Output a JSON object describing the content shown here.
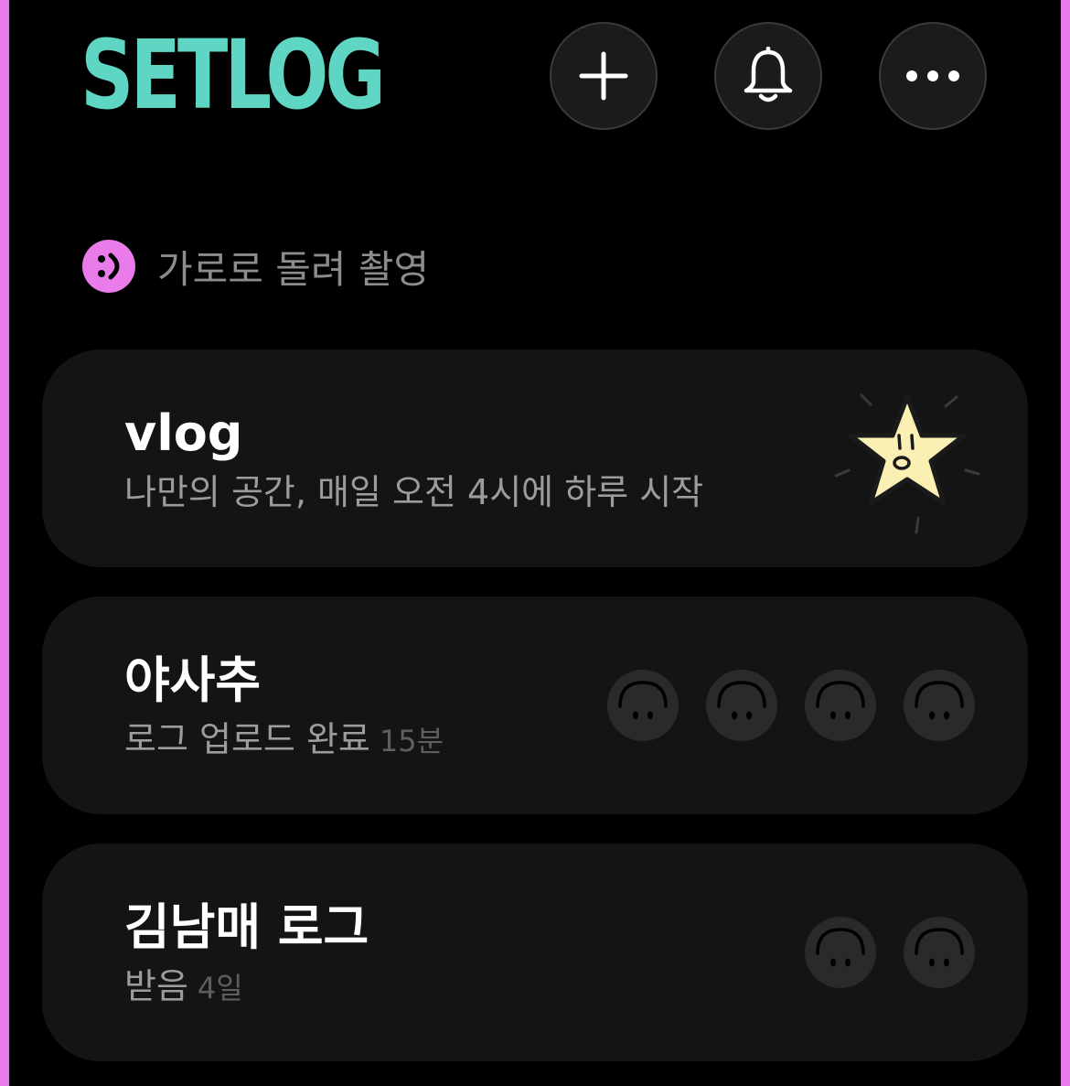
{
  "app": {
    "logo_text": "SETLOG",
    "accent_color": "#5fd6c4",
    "frame_color": "#ea7bea"
  },
  "header": {
    "buttons": [
      {
        "name": "add",
        "icon": "plus-icon"
      },
      {
        "name": "notifications",
        "icon": "bell-icon"
      },
      {
        "name": "more",
        "icon": "more-horizontal-icon"
      }
    ]
  },
  "hint": {
    "icon": "smile-rotate-icon",
    "text": "가로로 돌려 촬영"
  },
  "logs": [
    {
      "title": "vlog",
      "subtitle": "나만의 공간, 매일 오전 4시에 하루 시작",
      "time": "",
      "icon": "star-face-icon"
    },
    {
      "title": "야사추",
      "subtitle": "로그 업로드 완료",
      "time": "15분",
      "member_count": 4
    },
    {
      "title": "김남매 로그",
      "subtitle": "받음",
      "time": "4일",
      "member_count": 2
    }
  ]
}
